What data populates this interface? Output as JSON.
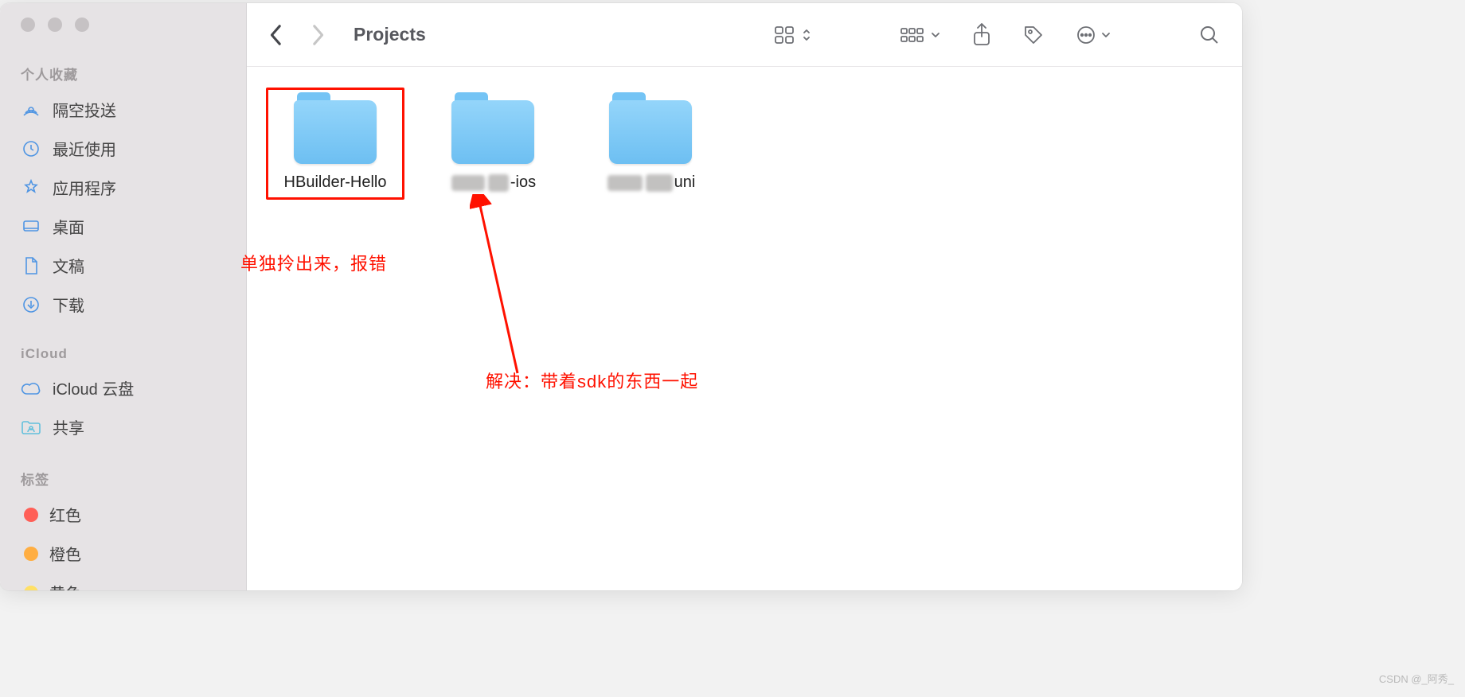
{
  "toolbar": {
    "title": "Projects"
  },
  "sidebar": {
    "favorites": {
      "title": "个人收藏",
      "items": [
        {
          "label": "隔空投送"
        },
        {
          "label": "最近使用"
        },
        {
          "label": "应用程序"
        },
        {
          "label": "桌面"
        },
        {
          "label": "文稿"
        },
        {
          "label": "下载"
        }
      ]
    },
    "icloud": {
      "title": "iCloud",
      "items": [
        {
          "label": "iCloud 云盘"
        },
        {
          "label": "共享"
        }
      ]
    },
    "tags": {
      "title": "标签",
      "items": [
        {
          "label": "红色",
          "color": "#ff5f57"
        },
        {
          "label": "橙色",
          "color": "#ffae42"
        },
        {
          "label": "黄色",
          "color": "#ffe066"
        }
      ]
    }
  },
  "folders": [
    {
      "label": "HBuilder-Hello",
      "highlighted": true
    },
    {
      "label_suffix": "-ios",
      "obscured": true
    },
    {
      "label_suffix": "uni",
      "obscured": true
    }
  ],
  "annotations": {
    "left": "单独拎出来，报错",
    "center": "解决：带着sdk的东西一起"
  },
  "watermark": "CSDN @_阿秀_"
}
